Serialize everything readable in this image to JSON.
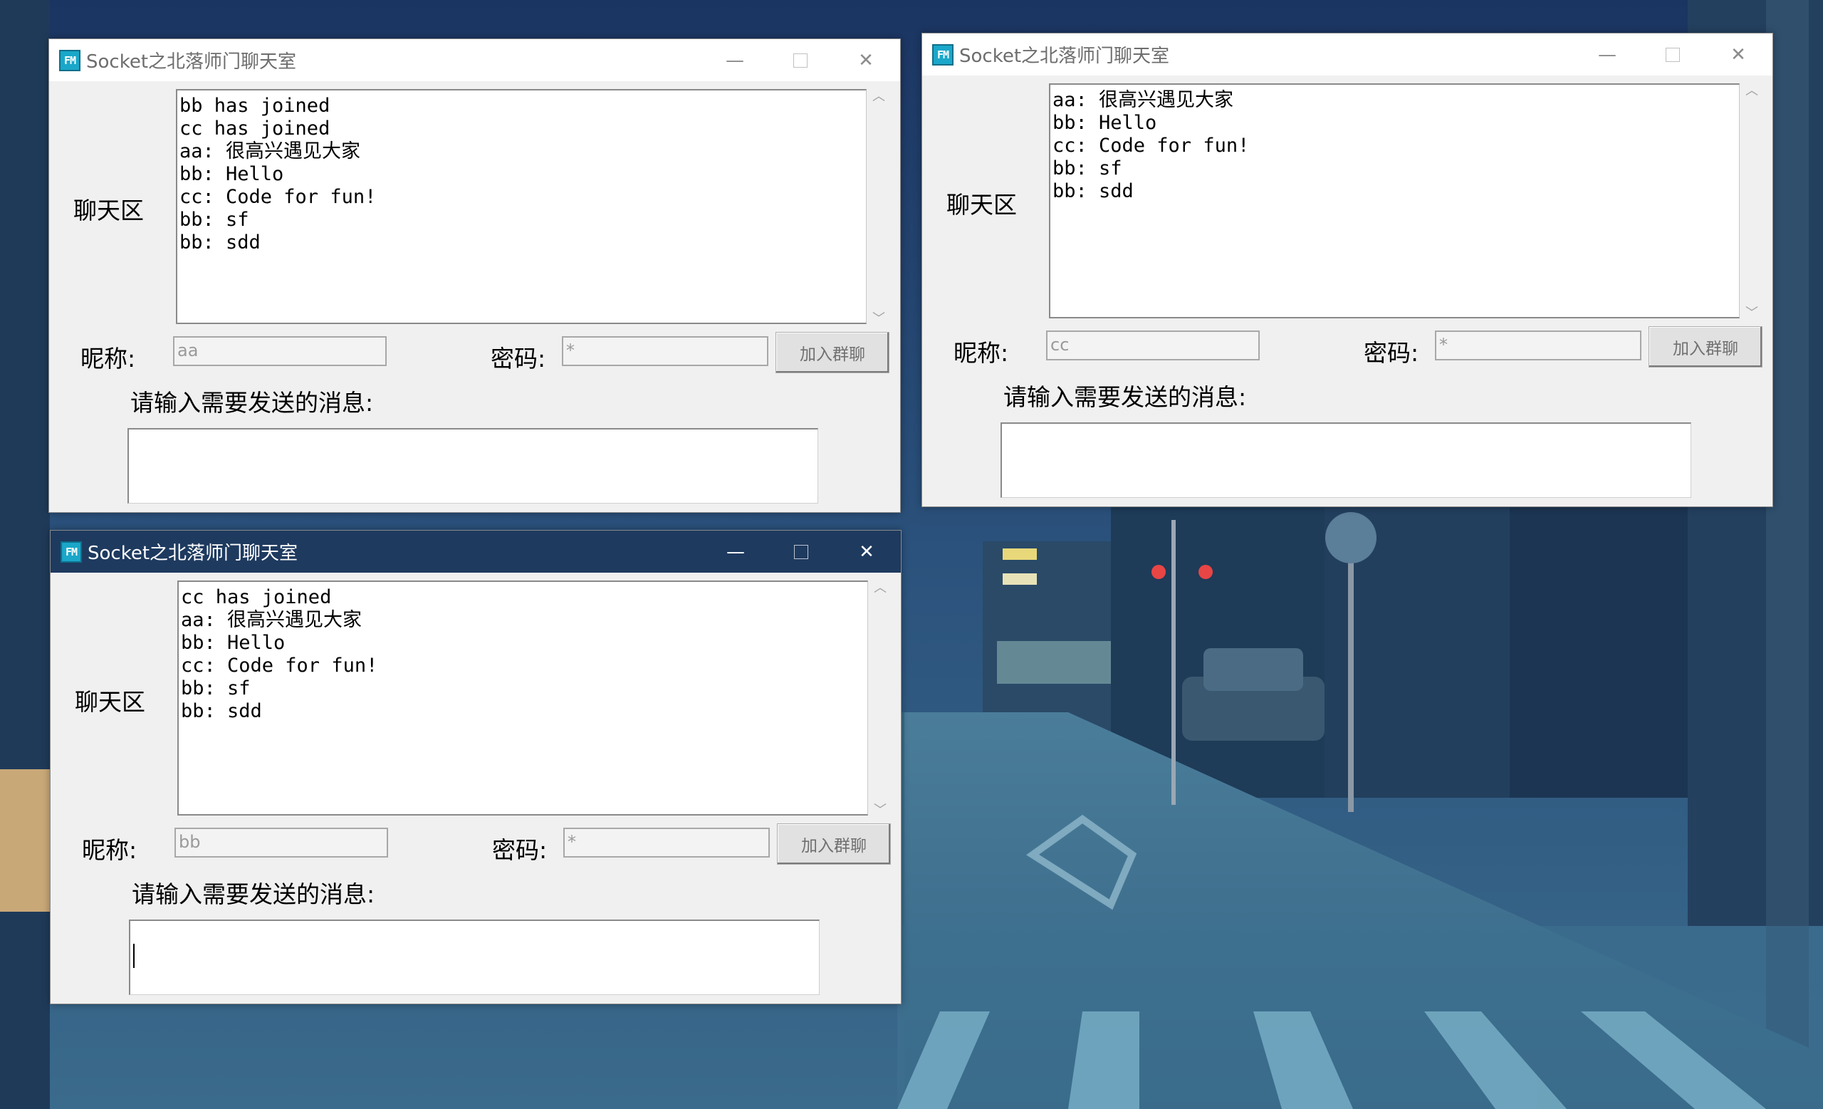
{
  "app": {
    "window_title": "Socket之北落师门聊天室",
    "icon_text": "FM"
  },
  "labels": {
    "chat_area": "聊天区",
    "nickname": "昵称:",
    "password": "密码:",
    "join_button": "加入群聊",
    "send_prompt": "请输入需要发送的消息:"
  },
  "titlebar_buttons": {
    "minimize": "—",
    "close": "✕"
  },
  "windows": [
    {
      "id": "window-aa",
      "active": false,
      "nickname_value": "aa",
      "password_value": "*",
      "chat_lines": [
        "bb has joined",
        "cc has joined",
        "aa: 很高兴遇见大家",
        "bb: Hello",
        "cc: Code for fun!",
        "bb: sf",
        "bb: sdd"
      ],
      "message_value": ""
    },
    {
      "id": "window-cc",
      "active": false,
      "nickname_value": "cc",
      "password_value": "*",
      "chat_lines": [
        "aa: 很高兴遇见大家",
        "bb: Hello",
        "cc: Code for fun!",
        "bb: sf",
        "bb: sdd"
      ],
      "message_value": ""
    },
    {
      "id": "window-bb",
      "active": true,
      "nickname_value": "bb",
      "password_value": "*",
      "chat_lines": [
        "cc has joined",
        "aa: 很高兴遇见大家",
        "bb: Hello",
        "cc: Code for fun!",
        "bb: sf",
        "bb: sdd"
      ],
      "message_value": ""
    }
  ],
  "colors": {
    "active_titlebar": "#1e3a5f",
    "window_bg": "#f0f0f0",
    "app_icon": "#1aa7c9"
  }
}
